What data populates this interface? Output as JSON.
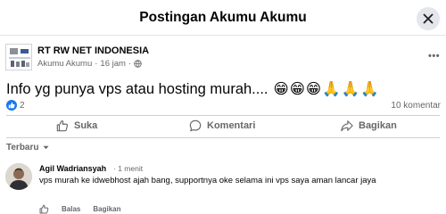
{
  "dialog": {
    "title": "Postingan Akumu Akumu"
  },
  "post": {
    "page_name": "RT RW NET INDONESIA",
    "author": "Akumu Akumu",
    "time": "16 jam",
    "text": "Info yg punya vps atau hosting murah....",
    "emojis": [
      "😁",
      "😁",
      "😁",
      "🙏",
      "🙏",
      "🙏"
    ],
    "reaction_count": "2",
    "comment_count": "10 komentar",
    "privacy_icon": "globe-icon"
  },
  "actions": {
    "like": "Suka",
    "comment": "Komentari",
    "share": "Bagikan"
  },
  "comments_sort": "Terbaru",
  "comment": {
    "author": "Agil Wadriansyah",
    "time": "1 menit",
    "text": "vps murah ke idwebhost ajah bang, supportnya oke selama ini vps saya aman lancar jaya",
    "reply_label": "Balas",
    "share_label": "Bagikan"
  },
  "colors": {
    "accent": "#1877f2",
    "muted_text": "#65676b",
    "divider": "#ced0d4"
  }
}
